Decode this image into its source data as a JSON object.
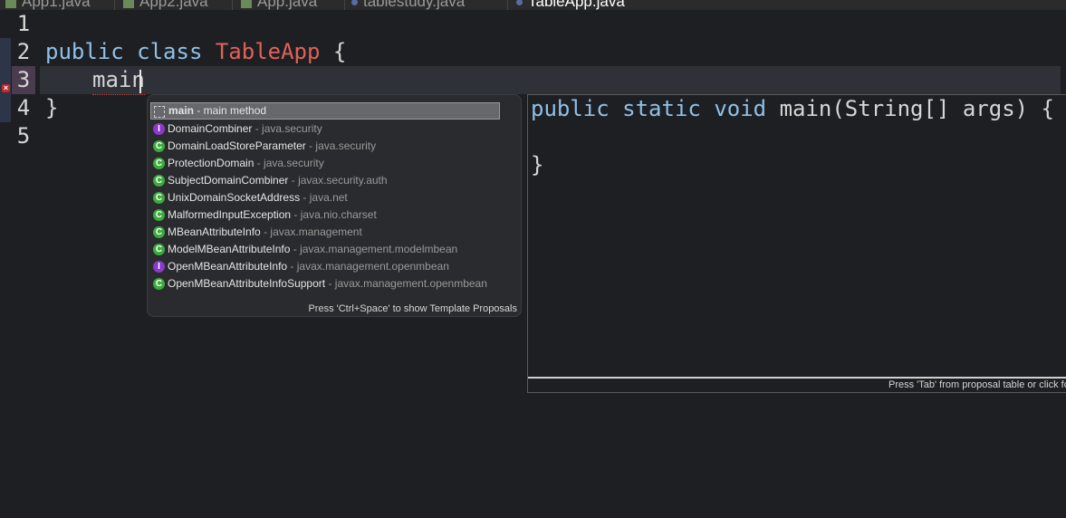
{
  "tabs": [
    {
      "label": "App1.java"
    },
    {
      "label": "App2.java"
    },
    {
      "label": "App.java"
    },
    {
      "label": "tablestudy.java"
    },
    {
      "label": "TableApp.java"
    }
  ],
  "editor": {
    "line_numbers": [
      "1",
      "2",
      "3",
      "4",
      "5"
    ],
    "line2": {
      "kw1": "public",
      "kw2": "class",
      "class_name": "TableApp",
      "brace": "{"
    },
    "line3_typed": "main",
    "line4": "}"
  },
  "popup": {
    "proposals": [
      {
        "icon": "template-icon",
        "name": "main",
        "qualifier": " - main method"
      },
      {
        "icon": "interface-icon",
        "name": "DomainCombiner",
        "qualifier": " - java.security"
      },
      {
        "icon": "class-icon",
        "name": "DomainLoadStoreParameter",
        "qualifier": " - java.security"
      },
      {
        "icon": "class-icon",
        "name": "ProtectionDomain",
        "qualifier": " - java.security"
      },
      {
        "icon": "class-icon",
        "name": "SubjectDomainCombiner",
        "qualifier": " - javax.security.auth"
      },
      {
        "icon": "class-icon",
        "name": "UnixDomainSocketAddress",
        "qualifier": " - java.net"
      },
      {
        "icon": "class-icon",
        "name": "MalformedInputException",
        "qualifier": " - java.nio.charset"
      },
      {
        "icon": "class-icon",
        "name": "MBeanAttributeInfo",
        "qualifier": " - javax.management"
      },
      {
        "icon": "class-icon",
        "name": "ModelMBeanAttributeInfo",
        "qualifier": " - javax.management.modelmbean"
      },
      {
        "icon": "interface-icon",
        "name": "OpenMBeanAttributeInfo",
        "qualifier": " - javax.management.openmbean"
      },
      {
        "icon": "class-icon",
        "name": "OpenMBeanAttributeInfoSupport",
        "qualifier": " - javax.management.openmbean"
      }
    ],
    "footer": "Press 'Ctrl+Space' to show Template Proposals"
  },
  "info_panel": {
    "line1": "public static void main(String[] args) {",
    "line2": "",
    "line3": "}",
    "footer": "Press 'Tab' from proposal table or click for focus"
  },
  "colors": {
    "keyword": "#8fc0e8",
    "class_name": "#e0625a",
    "class_icon": "#3bab3b",
    "interface_icon": "#8a3ac8",
    "error": "#c8282a"
  }
}
